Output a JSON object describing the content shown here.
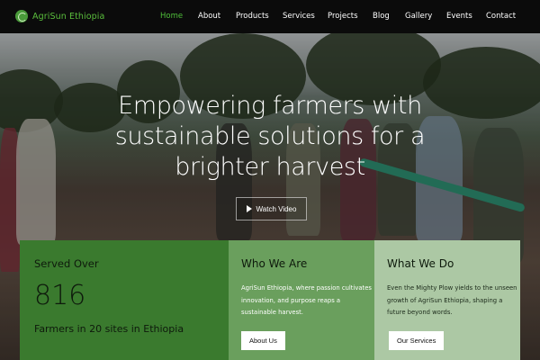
{
  "header": {
    "brand": "AgriSun Ethiopia",
    "brand_icon": "sun-leaf-icon",
    "nav": [
      {
        "label": "Home",
        "active": true
      },
      {
        "label": "About",
        "active": false
      },
      {
        "label": "Products",
        "active": false
      },
      {
        "label": "Services",
        "active": false
      },
      {
        "label": "Projects",
        "active": false
      },
      {
        "label": "Blog",
        "active": false
      },
      {
        "label": "Gallery",
        "active": false
      },
      {
        "label": "Events",
        "active": false
      },
      {
        "label": "Contact",
        "active": false
      }
    ]
  },
  "hero": {
    "headline": "Empowering farmers with sustainable solutions for a brighter harvest",
    "watch_button": "Watch Video",
    "watch_icon": "play-icon"
  },
  "served": {
    "label": "Served Over",
    "number": "816",
    "description": "Farmers in 20 sites in Ethiopia"
  },
  "who": {
    "title": "Who We Are",
    "text": "AgriSun Ethiopia, where passion cultivates innovation, and purpose reaps a sustainable harvest.",
    "button": "About Us"
  },
  "what": {
    "title": "What We Do",
    "text": "Even the Mighty Plow yields to the unseen growth of AgriSun Ethiopia, shaping a future beyond words.",
    "button": "Our Services"
  },
  "colors": {
    "nav_active": "#4fbf3a",
    "brand": "#5bbf3d",
    "card_served": "#3a7a2e",
    "card_who": "#6a9f5d",
    "card_what": "#acc8a4"
  }
}
